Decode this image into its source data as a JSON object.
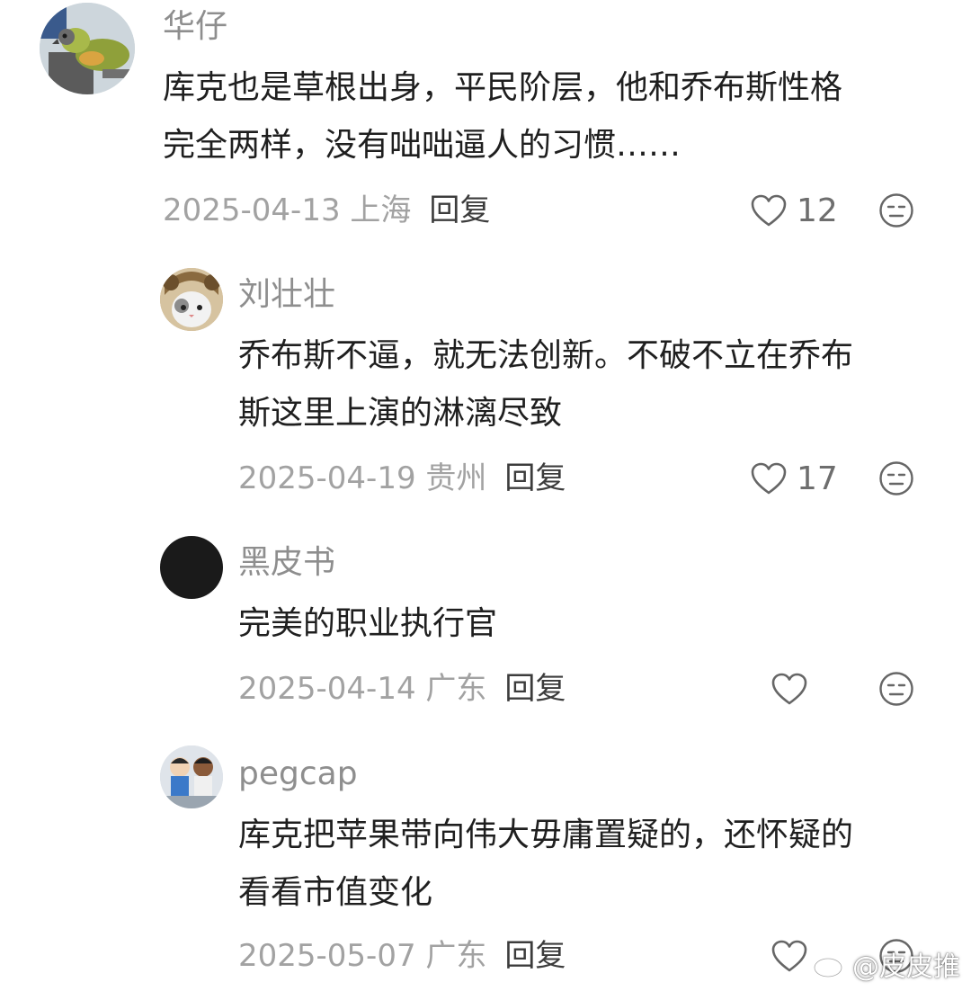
{
  "comments": [
    {
      "name": "华仔",
      "lines": [
        "库克也是草根出身，平民阶层，他和乔布斯性格",
        "完全两样，没有咄咄逼人的习惯……"
      ],
      "date_location": "2025-04-13 上海",
      "reply_label": "回复",
      "likes": "12",
      "avatar": "parrot"
    },
    {
      "name": "刘壮壮",
      "lines": [
        "乔布斯不逼，就无法创新。不破不立在乔布",
        "斯这里上演的淋漓尽致"
      ],
      "date_location": "2025-04-19 贵州",
      "reply_label": "回复",
      "likes": "17",
      "avatar": "cat"
    },
    {
      "name": "黑皮书",
      "lines": [
        "完美的职业执行官"
      ],
      "date_location": "2025-04-14 广东",
      "reply_label": "回复",
      "likes": "",
      "avatar": "black-circle"
    },
    {
      "name": "pegcap",
      "lines": [
        "库克把苹果带向伟大毋庸置疑的，还怀疑的",
        "看看市值变化"
      ],
      "date_location": "2025-05-07 广东",
      "reply_label": "回复",
      "likes": "",
      "avatar": "cartoon"
    }
  ],
  "watermark": "@皮皮推"
}
